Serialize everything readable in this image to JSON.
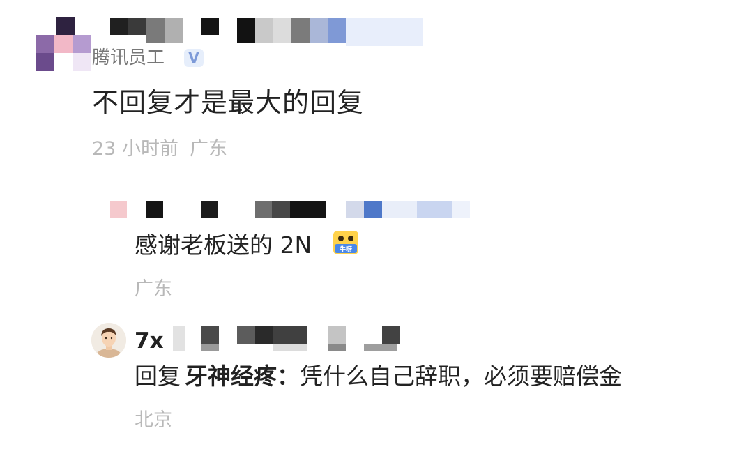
{
  "comment": {
    "author_tag": "腾讯员工",
    "verified_badge": "V",
    "text": "不回复才是最大的回复",
    "time": "23 小时前",
    "location": "广东"
  },
  "replies": [
    {
      "text": "感谢老板送的 2N",
      "emoji": "牛呀-icon",
      "emoji_label": "牛呀",
      "location": "广东"
    },
    {
      "author_visible": "7x",
      "reply_prefix": "回复",
      "reply_target": "牙神经疼：",
      "text": "凭什么自己辞职，必须要赔偿金",
      "location": "北京",
      "avatar": "avatar-icon"
    }
  ],
  "colors": {
    "meta_text": "#b8b8b8",
    "body_text": "#222222",
    "verified_badge": "#7d9ad8"
  }
}
